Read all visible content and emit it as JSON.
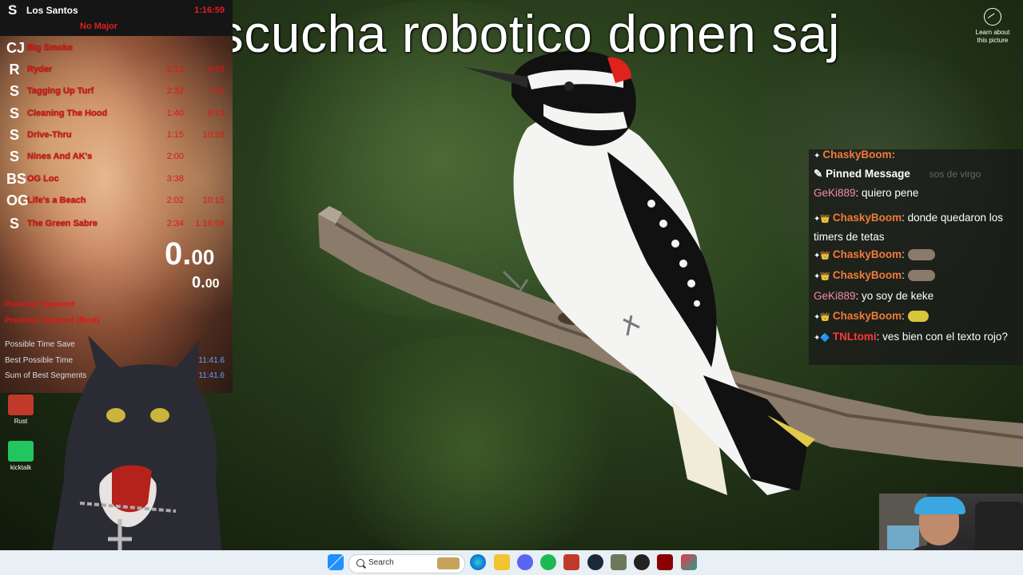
{
  "caption": "se escucha robotico donen saj",
  "learn_about": {
    "line1": "Learn about",
    "line2": "this picture"
  },
  "splits": {
    "title": "Los Santos",
    "title_time": "1:16:59",
    "subtitle": "No Major",
    "rows": [
      {
        "icon": "CJ",
        "name": "Big Smoke",
        "delta": "",
        "time": ""
      },
      {
        "icon": "R",
        "name": "Ryder",
        "delta": "2:12",
        "time": "4:59"
      },
      {
        "icon": "S",
        "name": "Tagging Up Turf",
        "delta": "2:32",
        "time": "7:32"
      },
      {
        "icon": "S",
        "name": "Cleaning The Hood",
        "delta": "1:40",
        "time": "9:13"
      },
      {
        "icon": "S",
        "name": "Drive-Thru",
        "delta": "1:15",
        "time": "10:28"
      },
      {
        "icon": "S",
        "name": "Nines And AK's",
        "delta": "2:00",
        "time": ""
      },
      {
        "icon": "BS",
        "name": "OG Loc",
        "delta": "3:38",
        "time": ""
      },
      {
        "icon": "OG",
        "name": "Life's a Beach",
        "delta": "2:02",
        "time": "10:15"
      },
      {
        "icon": "S",
        "name": "The Green Sabre",
        "delta": "2:34",
        "time": "1:16:59"
      }
    ],
    "timer_main": "0.",
    "timer_main_small": "00",
    "timer_sub": "0.",
    "timer_sub_small": "00",
    "previous_segment": "Previous Segment",
    "previous_segment_best": "Previous Segment (Best)",
    "possible_time_save": "Possible Time Save",
    "best_possible_time_label": "Best Possible Time",
    "best_possible_time_value": "11:41.6",
    "sum_of_best_label": "Sum of Best Segments",
    "sum_of_best_value": "11:41.6"
  },
  "desktop_icons": [
    {
      "label": "Rust"
    },
    {
      "label": "kicktalk"
    }
  ],
  "chat": {
    "top_user": "ChaskyBoom:",
    "pinned_label": "Pinned Message",
    "pinned_ghost": "sos de virgo",
    "messages": [
      {
        "user": "GeKi889",
        "text": ": quiero pene",
        "kind": "geki"
      },
      {
        "user": "ChaskyBoom",
        "text": ": donde quedaron los timers de tetas",
        "kind": "chasky"
      },
      {
        "user": "ChaskyBoom",
        "text": ":",
        "kind": "chasky"
      },
      {
        "user": "ChaskyBoom",
        "text": ":",
        "kind": "chasky"
      },
      {
        "user": "GeKi889",
        "text": ": yo soy de keke",
        "kind": "geki"
      },
      {
        "user": "ChaskyBoom",
        "text": ":",
        "kind": "chasky"
      },
      {
        "user": "TNLtomi",
        "text": ": ves bien con el texto rojo?",
        "kind": "tnl"
      }
    ]
  },
  "taskbar": {
    "search_placeholder": "Search"
  },
  "colors": {
    "split_red": "#e01515",
    "chasky": "#f17b3a",
    "geki": "#f78aa8",
    "tnl": "#ff3838"
  }
}
